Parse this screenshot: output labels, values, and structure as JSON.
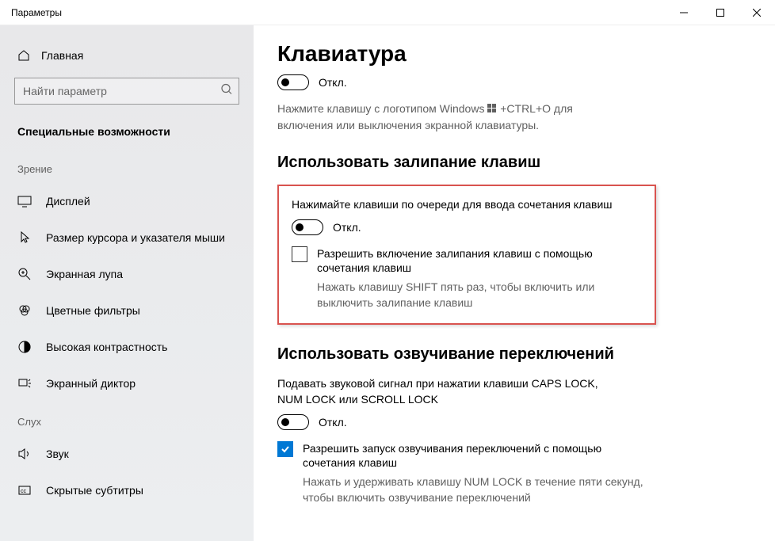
{
  "window": {
    "title": "Параметры"
  },
  "sidebar": {
    "home": "Главная",
    "search_placeholder": "Найти параметр",
    "category": "Специальные возможности",
    "group_vision": "Зрение",
    "group_hearing": "Слух",
    "items_vision": [
      {
        "label": "Дисплей"
      },
      {
        "label": "Размер курсора и указателя мыши"
      },
      {
        "label": "Экранная лупа"
      },
      {
        "label": "Цветные фильтры"
      },
      {
        "label": "Высокая контрастность"
      },
      {
        "label": "Экранный диктор"
      }
    ],
    "items_hearing": [
      {
        "label": "Звук"
      },
      {
        "label": "Скрытые субтитры"
      }
    ]
  },
  "content": {
    "page_title": "Клавиатура",
    "toggle1_label": "Откл.",
    "hint1_before": "Нажмите клавишу с логотипом Windows ",
    "hint1_after": " +CTRL+O для включения или выключения экранной клавиатуры.",
    "section_sticky": "Использовать залипание клавиш",
    "sticky_desc": "Нажимайте клавиши по очереди для ввода сочетания клавиш",
    "sticky_toggle": "Откл.",
    "sticky_check": "Разрешить включение залипания клавиш с помощью сочетания клавиш",
    "sticky_hint": "Нажать клавишу SHIFT пять раз, чтобы включить или выключить залипание клавиш",
    "section_toggle_keys": "Использовать озвучивание переключений",
    "tk_desc": "Подавать звуковой сигнал при нажатии клавиши CAPS LOCK, NUM LOCK или SCROLL LOCK",
    "tk_toggle": "Откл.",
    "tk_check": "Разрешить запуск озвучивания переключений с помощью сочетания клавиш",
    "tk_hint": "Нажать и удерживать клавишу NUM LOCK в течение пяти секунд, чтобы включить озвучивание переключений"
  }
}
